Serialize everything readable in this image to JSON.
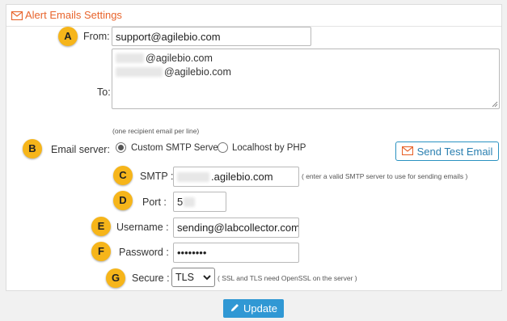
{
  "panel": {
    "title": "Alert Emails Settings",
    "icon": "envelope-icon"
  },
  "markers": [
    "A",
    "B",
    "C",
    "D",
    "E",
    "F",
    "G"
  ],
  "from": {
    "label": "From:",
    "value": "support@agilebio.com"
  },
  "to": {
    "label": "To:",
    "lines": [
      "@agilebio.com",
      "@agilebio.com"
    ],
    "hint": "(one recipient email per line)"
  },
  "email_server": {
    "label": "Email server:",
    "options": [
      {
        "label": "Custom SMTP Server",
        "selected": true
      },
      {
        "label": "Localhost by PHP",
        "selected": false
      }
    ]
  },
  "send_test_button": {
    "label": "Send Test Email",
    "icon": "envelope-icon"
  },
  "smtp": {
    "label": "SMTP :",
    "value": ".agilebio.com",
    "hint": "( enter a valid SMTP server to use for sending emails )"
  },
  "port": {
    "label": "Port :",
    "value": "5"
  },
  "username": {
    "label": "Username :",
    "value": "sending@labcollector.com"
  },
  "password": {
    "label": "Password :",
    "value": "••••••••"
  },
  "secure": {
    "label": "Secure :",
    "value": "TLS",
    "hint": "( SSL and TLS need OpenSSL on the server )"
  },
  "update_button": {
    "label": "Update",
    "icon": "pencil-icon"
  },
  "colors": {
    "accent_orange": "#e8642c",
    "badge": "#f6b51a",
    "button_blue": "#3098d4"
  }
}
